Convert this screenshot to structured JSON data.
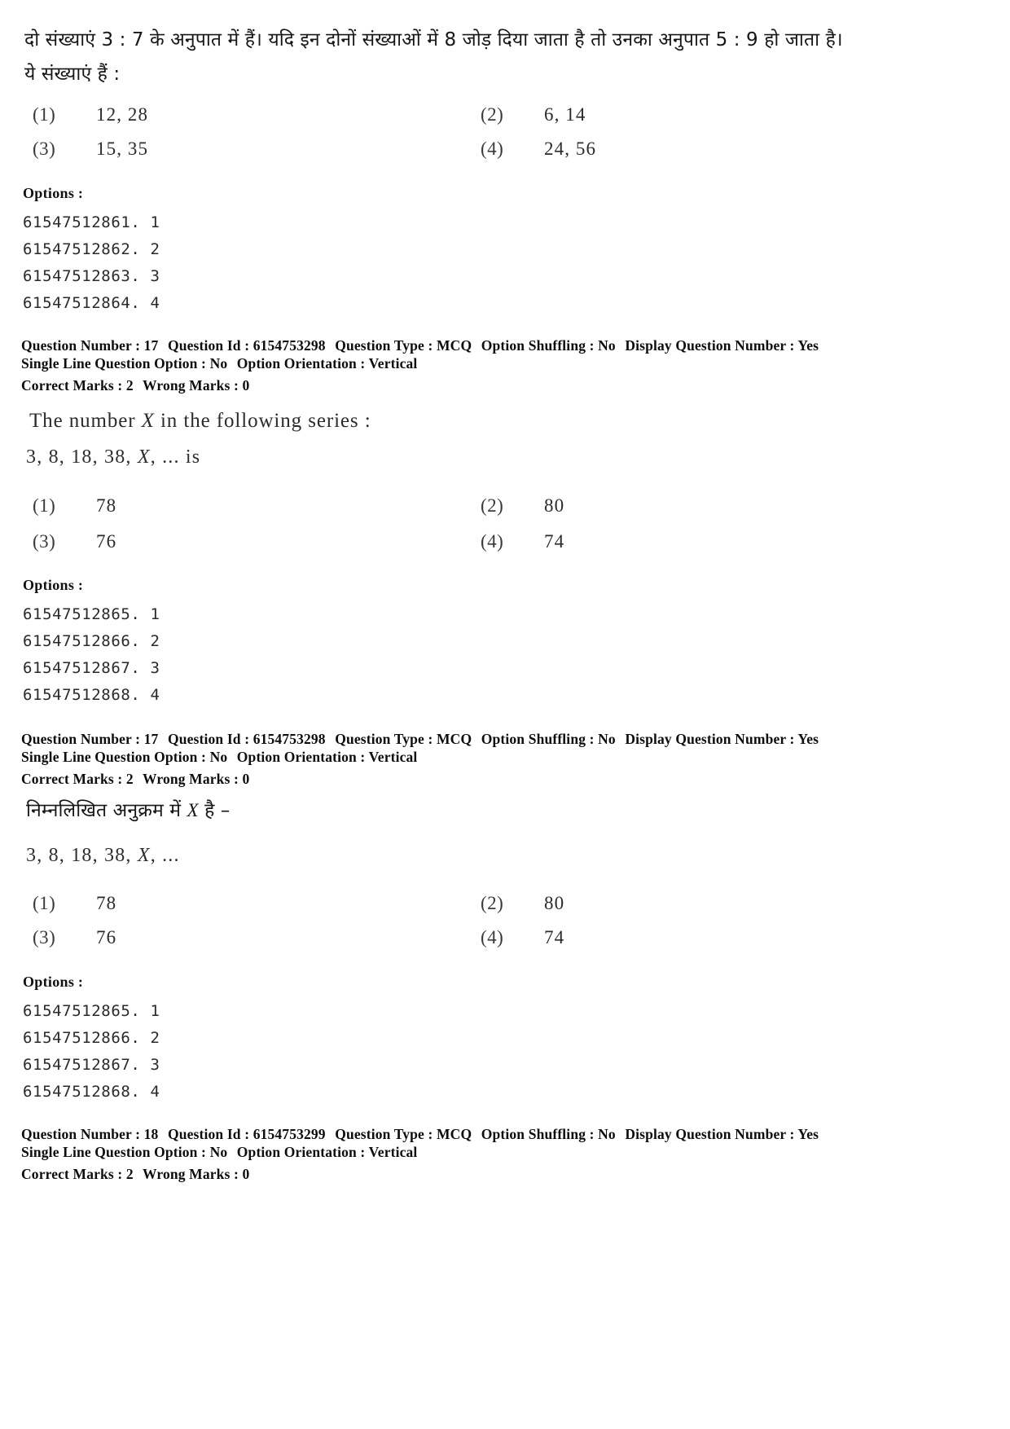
{
  "document": {
    "type": "exam-question-paper",
    "language_mode": "bilingual-hindi-english"
  },
  "q17_hindi": {
    "stem_line1": "दो संख्याएं 3 : 7 के अनुपात में हैं। यदि इन दोनों संख्याओं में 8 जोड़ दिया जाता है तो उनका अनुपात 5 : 9 हो जाता है।",
    "stem_line2": "ये संख्याएं हैं :",
    "choices": [
      {
        "num": "(1)",
        "value": "12, 28"
      },
      {
        "num": "(2)",
        "value": "6, 14"
      },
      {
        "num": "(3)",
        "value": "15, 35"
      },
      {
        "num": "(4)",
        "value": "24, 56"
      }
    ],
    "options_title": "Options :",
    "option_ids": [
      "61547512861. 1",
      "61547512862. 2",
      "61547512863. 3",
      "61547512864. 4"
    ]
  },
  "meta_block_1": {
    "question_number_label": "Question Number :",
    "question_number_value": "17",
    "question_id_label": "Question Id :",
    "question_id_value": "6154753298",
    "question_type_label": "Question Type :",
    "question_type_value": "MCQ",
    "option_shuffling_label": "Option Shuffling :",
    "option_shuffling_value": "No",
    "display_question_number_label": "Display Question Number :",
    "display_question_number_value": "Yes",
    "single_line_label": "Single Line Question Option :",
    "single_line_value": "No",
    "option_orientation_label": "Option Orientation :",
    "option_orientation_value": "Vertical",
    "correct_marks_label": "Correct Marks :",
    "correct_marks_value": "2",
    "wrong_marks_label": "Wrong Marks :",
    "wrong_marks_value": "0"
  },
  "q17_english": {
    "stem_pre": "The number ",
    "stem_var": "X",
    "stem_post": " in the following series :",
    "series_pre": "3, 8, 18, 38, ",
    "series_var": "X",
    "series_post": ", ... is",
    "choices": [
      {
        "num": "(1)",
        "value": "78"
      },
      {
        "num": "(2)",
        "value": "80"
      },
      {
        "num": "(3)",
        "value": "76"
      },
      {
        "num": "(4)",
        "value": "74"
      }
    ],
    "options_title": "Options :",
    "option_ids": [
      "61547512865. 1",
      "61547512866. 2",
      "61547512867. 3",
      "61547512868. 4"
    ]
  },
  "meta_block_2": {
    "question_number_label": "Question Number :",
    "question_number_value": "17",
    "question_id_label": "Question Id :",
    "question_id_value": "6154753298",
    "question_type_label": "Question Type :",
    "question_type_value": "MCQ",
    "option_shuffling_label": "Option Shuffling :",
    "option_shuffling_value": "No",
    "display_question_number_label": "Display Question Number :",
    "display_question_number_value": "Yes",
    "single_line_label": "Single Line Question Option :",
    "single_line_value": "No",
    "option_orientation_label": "Option Orientation :",
    "option_orientation_value": "Vertical",
    "correct_marks_label": "Correct Marks :",
    "correct_marks_value": "2",
    "wrong_marks_label": "Wrong Marks :",
    "wrong_marks_value": "0"
  },
  "q17_hindi_series": {
    "stem_pre": "निम्नलिखित अनुक्रम में ",
    "stem_var": "X",
    "stem_post": " है –",
    "series_pre": "3, 8, 18, 38, ",
    "series_var": "X",
    "series_post": ", ...",
    "choices": [
      {
        "num": "(1)",
        "value": "78"
      },
      {
        "num": "(2)",
        "value": "80"
      },
      {
        "num": "(3)",
        "value": "76"
      },
      {
        "num": "(4)",
        "value": "74"
      }
    ],
    "options_title": "Options :",
    "option_ids": [
      "61547512865. 1",
      "61547512866. 2",
      "61547512867. 3",
      "61547512868. 4"
    ]
  },
  "meta_block_3": {
    "question_number_label": "Question Number :",
    "question_number_value": "18",
    "question_id_label": "Question Id :",
    "question_id_value": "6154753299",
    "question_type_label": "Question Type :",
    "question_type_value": "MCQ",
    "option_shuffling_label": "Option Shuffling :",
    "option_shuffling_value": "No",
    "display_question_number_label": "Display Question Number :",
    "display_question_number_value": "Yes",
    "single_line_label": "Single Line Question Option :",
    "single_line_value": "No",
    "option_orientation_label": "Option Orientation :",
    "option_orientation_value": "Vertical",
    "correct_marks_label": "Correct Marks :",
    "correct_marks_value": "2",
    "wrong_marks_label": "Wrong Marks :",
    "wrong_marks_value": "0"
  }
}
